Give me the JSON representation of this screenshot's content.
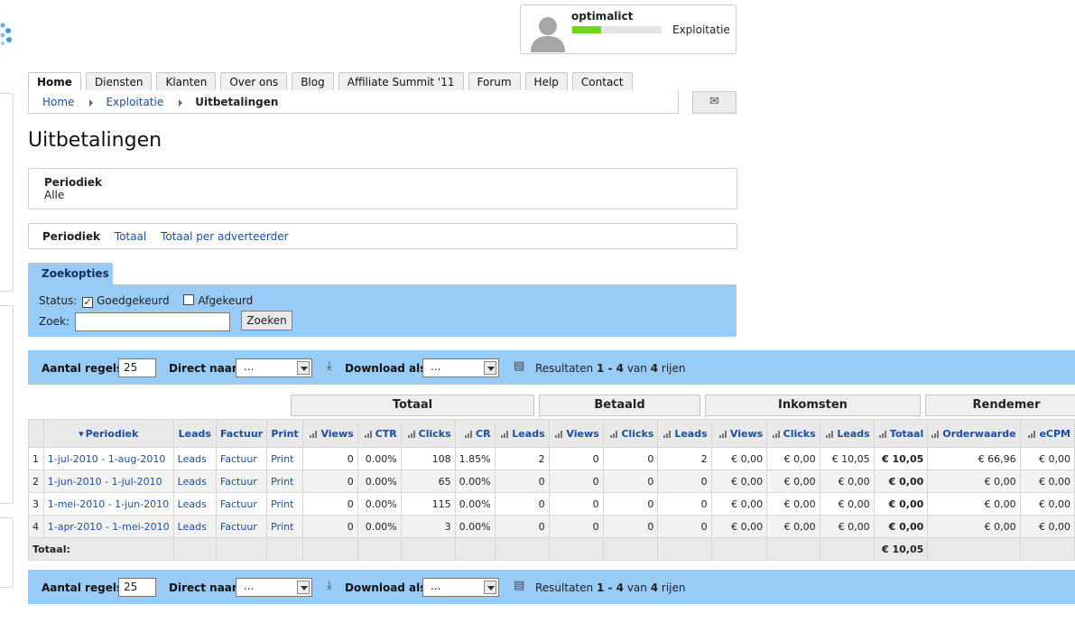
{
  "user": {
    "name": "optimalict",
    "level_fraction": 0.32,
    "status": "Exploitatie"
  },
  "nav": {
    "tabs": [
      "Home",
      "Diensten",
      "Klanten",
      "Over ons",
      "Blog",
      "Affiliate Summit '11",
      "Forum",
      "Help",
      "Contact"
    ],
    "active": "Home",
    "crumbs": [
      "Home",
      "Exploitatie",
      "Uitbetalingen"
    ]
  },
  "page": {
    "title": "Uitbetalingen",
    "periodiek_label": "Periodiek",
    "periodiek_value": "Alle",
    "subnav": [
      "Periodiek",
      "Totaal",
      "Totaal per adverteerder"
    ]
  },
  "search": {
    "tab": "Zoekopties",
    "status_label": "Status:",
    "opt1": "Goedgekeurd",
    "opt1_checked": true,
    "opt2": "Afgekeurd",
    "opt2_checked": false,
    "zoek_label": "Zoek:",
    "zoek_value": "",
    "button": "Zoeken"
  },
  "toolbar": {
    "rows_label": "Aantal regels:",
    "rows_value": "25",
    "direct_label": "Direct naar:",
    "direct_value": "...",
    "download_label": "Download als:",
    "download_value": "...",
    "res_prefix": "Resultaten",
    "res_range": "1 - 4",
    "res_mid": "van",
    "res_total": "4",
    "res_suffix": "rijen"
  },
  "groups": [
    "Totaal",
    "Betaald",
    "Inkomsten",
    "Rendemer"
  ],
  "table": {
    "headers": [
      "",
      "Periodiek",
      "Leads",
      "Factuur",
      "Print",
      "Views",
      "CTR",
      "Clicks",
      "CR",
      "Leads",
      "Views",
      "Clicks",
      "Leads",
      "Views",
      "Clicks",
      "Leads",
      "Totaal",
      "Orderwaarde",
      "eCPM"
    ],
    "rows": [
      [
        "1",
        "1-jul-2010 - 1-aug-2010",
        "Leads",
        "Factuur",
        "Print",
        "0",
        "0.00%",
        "108",
        "1.85%",
        "2",
        "0",
        "0",
        "2",
        "€ 0,00",
        "€ 0,00",
        "€ 10,05",
        "€ 10,05",
        "€ 66,96",
        "€ 0,00"
      ],
      [
        "2",
        "1-jun-2010 - 1-jul-2010",
        "Leads",
        "Factuur",
        "Print",
        "0",
        "0.00%",
        "65",
        "0.00%",
        "0",
        "0",
        "0",
        "0",
        "€ 0,00",
        "€ 0,00",
        "€ 0,00",
        "€ 0,00",
        "€ 0,00",
        "€ 0,00"
      ],
      [
        "3",
        "1-mei-2010 - 1-jun-2010",
        "Leads",
        "Factuur",
        "Print",
        "0",
        "0.00%",
        "115",
        "0.00%",
        "0",
        "0",
        "0",
        "0",
        "€ 0,00",
        "€ 0,00",
        "€ 0,00",
        "€ 0,00",
        "€ 0,00",
        "€ 0,00"
      ],
      [
        "4",
        "1-apr-2010 - 1-mei-2010",
        "Leads",
        "Factuur",
        "Print",
        "0",
        "0.00%",
        "3",
        "0.00%",
        "0",
        "0",
        "0",
        "0",
        "€ 0,00",
        "€ 0,00",
        "€ 0,00",
        "€ 0,00",
        "€ 0,00",
        "€ 0,00"
      ]
    ],
    "total_label": "Totaal:",
    "total_value": "€ 10,05"
  }
}
